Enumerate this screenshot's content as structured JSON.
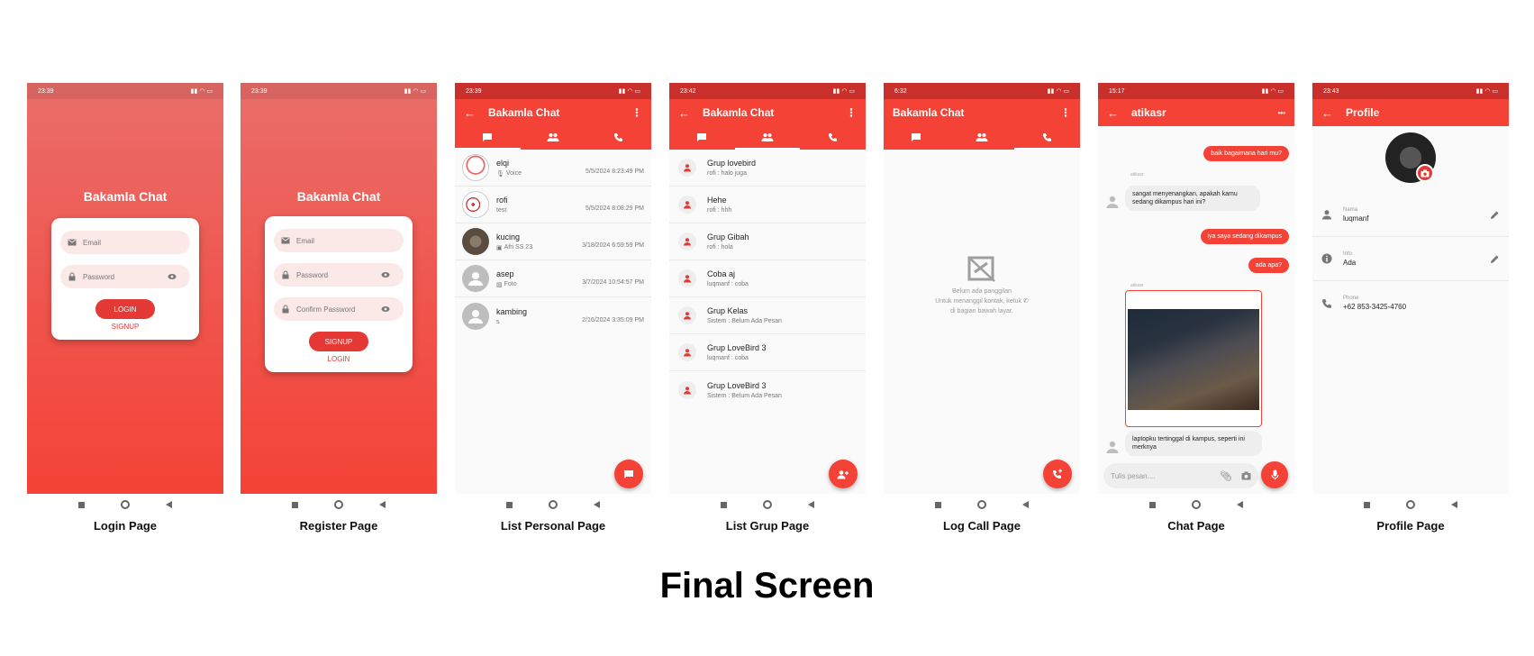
{
  "colors": {
    "primary": "#f44336",
    "primary_dark": "#c9302c",
    "accent_light": "#fbe9e7"
  },
  "captions": {
    "login": "Login Page",
    "register": "Register Page",
    "list_personal": "List Personal Page",
    "list_group": "List Grup Page",
    "log_call": "Log Call Page",
    "chat": "Chat Page",
    "profile": "Profile Page"
  },
  "final_title": "Final Screen",
  "status_times": {
    "login": "23:39",
    "register": "23:39",
    "personal": "23:39",
    "group": "23:42",
    "call": "6:32",
    "chat": "15:17",
    "profile": "23:43"
  },
  "login": {
    "brand": "Bakamla Chat",
    "email_placeholder": "Email",
    "password_placeholder": "Password",
    "login_button": "LOGIN",
    "signup_link": "SIGNUP"
  },
  "register": {
    "brand": "Bakamla Chat",
    "email_placeholder": "Email",
    "password_placeholder": "Password",
    "confirm_placeholder": "Confirm Password",
    "signup_button": "SIGNUP",
    "login_link": "LOGIN"
  },
  "app_title": "Bakamla Chat",
  "personal": [
    {
      "name": "elqi",
      "sub": "Voice",
      "time": "5/5/2024 8:23:49 PM"
    },
    {
      "name": "rofi",
      "sub": "test",
      "time": "5/5/2024 8:08:29 PM"
    },
    {
      "name": "kucing",
      "sub": "Afri SS 23",
      "time": "3/18/2024 6:59:59 PM"
    },
    {
      "name": "asep",
      "sub": "Foto",
      "time": "3/7/2024 10:54:57 PM"
    },
    {
      "name": "kambing",
      "sub": "s",
      "time": "2/16/2024 3:35:09 PM"
    }
  ],
  "groups": [
    {
      "name": "Grup lovebird",
      "sub": "rofi : halo juga"
    },
    {
      "name": "Hehe",
      "sub": "rofi : hhh"
    },
    {
      "name": "Grup Gibah",
      "sub": "rofi : hola"
    },
    {
      "name": "Coba aj",
      "sub": "luqmanf : coba"
    },
    {
      "name": "Grup Kelas",
      "sub": "Sistem : Belum Ada Pesan"
    },
    {
      "name": "Grup LoveBird 3",
      "sub": "luqmanf : coba"
    },
    {
      "name": "Grup LoveBird 3",
      "sub": "Sistem : Belum Ada Pesan"
    }
  ],
  "log_call": {
    "line1": "Belum ada panggilan",
    "line2": "Untuk menanggil kontak, ketuk",
    "line3": "di bagian bawah layar."
  },
  "chat": {
    "contact": "atikasr",
    "sender": "atikasr",
    "msg1": "baik bagaimana hari mu?",
    "msg2": "sangat menyenangkan, apakah kamu sedang dikampus hari ini?",
    "msg3": "iya saya sedang dikampus",
    "msg4": "ada apa?",
    "msg5": "laptopku tertinggal di kampus, seperti ini merknya",
    "input_placeholder": "Tulis pesan...."
  },
  "profile": {
    "title": "Profile",
    "name_label": "Nama",
    "name_value": "luqmanf",
    "info_label": "Info",
    "info_value": "Ada",
    "phone_label": "Phone",
    "phone_value": "+62 853-3425-4760"
  }
}
